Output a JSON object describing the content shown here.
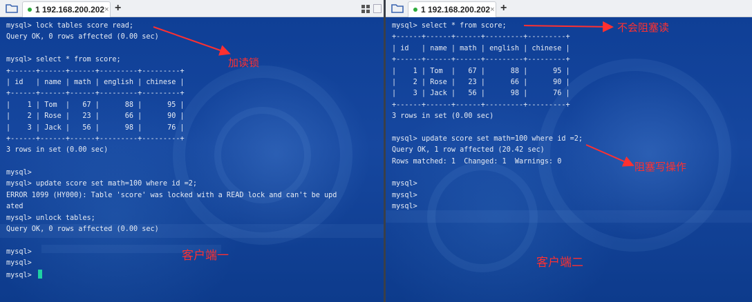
{
  "panes": [
    {
      "tab": {
        "label": "1 192.168.200.202",
        "close": "×",
        "status_color": "#2eaa3c"
      },
      "new_tab": "+",
      "lines": [
        "mysql> lock tables score read;",
        "Query OK, 0 rows affected (0.00 sec)",
        "",
        "mysql> select * from score;",
        "+------+------+------+---------+---------+",
        "| id   | name | math | english | chinese |",
        "+------+------+------+---------+---------+",
        "|    1 | Tom  |   67 |      88 |      95 |",
        "|    2 | Rose |   23 |      66 |      90 |",
        "|    3 | Jack |   56 |      98 |      76 |",
        "+------+------+------+---------+---------+",
        "3 rows in set (0.00 sec)",
        "",
        "mysql>",
        "mysql> update score set math=100 where id =2;",
        "ERROR 1099 (HY000): Table 'score' was locked with a READ lock and can't be upd",
        "ated",
        "mysql> unlock tables;",
        "Query OK, 0 rows affected (0.00 sec)",
        "",
        "mysql>",
        "mysql>",
        "mysql> "
      ],
      "annotations": {
        "read_lock": "加读锁",
        "client": "客户端一"
      }
    },
    {
      "tab": {
        "label": "1 192.168.200.202",
        "close": "×",
        "status_color": "#2eaa3c"
      },
      "new_tab": "+",
      "lines": [
        "mysql> select * from score;",
        "+------+------+------+---------+---------+",
        "| id   | name | math | english | chinese |",
        "+------+------+------+---------+---------+",
        "|    1 | Tom  |   67 |      88 |      95 |",
        "|    2 | Rose |   23 |      66 |      90 |",
        "|    3 | Jack |   56 |      98 |      76 |",
        "+------+------+------+---------+---------+",
        "3 rows in set (0.00 sec)",
        "",
        "mysql> update score set math=100 where id =2;",
        "Query OK, 1 row affected (20.42 sec)",
        "Rows matched: 1  Changed: 1  Warnings: 0",
        "",
        "mysql>",
        "mysql>",
        "mysql>"
      ],
      "annotations": {
        "no_block_read": "不会阻塞读",
        "block_write": "阻塞写操作",
        "client": "客户端二"
      }
    }
  ],
  "colors": {
    "annotation": "#ff3030",
    "terminal_text": "#e7ecf4",
    "cursor": "#1fd1a3"
  },
  "icons": {
    "folder": "folder-icon",
    "layout": "grid-layout-icon"
  }
}
